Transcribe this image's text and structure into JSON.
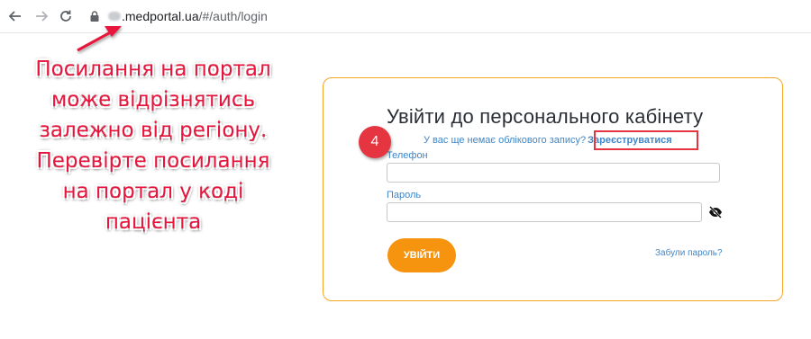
{
  "browser": {
    "url_domain": ".medportal.ua",
    "url_path": "/#/auth/login"
  },
  "annotation": {
    "lines": [
      "Посилання на портал",
      "може відрізнятись",
      "залежно від регіону.",
      "Перевірте посилання",
      "на портал у коді",
      "пацієнта"
    ],
    "color": "#e8143c"
  },
  "login": {
    "title": "Увійти до персонального кабінету",
    "no_account_text": "У вас ще немає облікового запису?",
    "register_link": "Зареєструватися",
    "phone_label": "Телефон",
    "password_label": "Пароль",
    "login_button": "УВІЙТИ",
    "forgot_link": "Забули пароль?",
    "accent_color": "#f7940f"
  },
  "step_badge": "4"
}
